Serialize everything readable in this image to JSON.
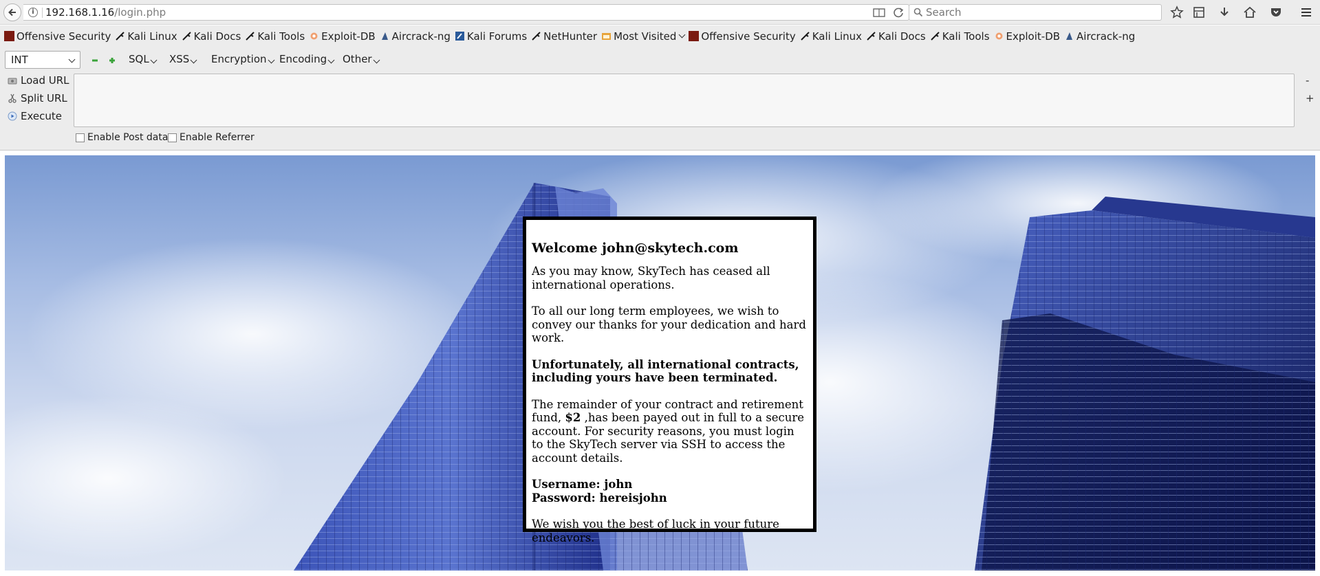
{
  "browser": {
    "url_host": "192.168.1.16",
    "url_path": "/login.php",
    "search_placeholder": "Search"
  },
  "bookmarks": [
    {
      "label": "Offensive Security",
      "icon": "offsec-icon"
    },
    {
      "label": "Kali Linux",
      "icon": "kali-dragon-icon"
    },
    {
      "label": "Kali Docs",
      "icon": "kali-dragon-icon"
    },
    {
      "label": "Kali Tools",
      "icon": "kali-dragon-icon"
    },
    {
      "label": "Exploit-DB",
      "icon": "exploitdb-icon"
    },
    {
      "label": "Aircrack-ng",
      "icon": "aircrack-icon"
    },
    {
      "label": "Kali Forums",
      "icon": "kali-forums-icon"
    },
    {
      "label": "NetHunter",
      "icon": "kali-dragon-icon"
    },
    {
      "label": "Most Visited",
      "icon": "folder-icon"
    },
    {
      "label": "Offensive Security",
      "icon": "offsec-icon"
    },
    {
      "label": "Kali Linux",
      "icon": "kali-dragon-icon"
    },
    {
      "label": "Kali Docs",
      "icon": "kali-dragon-icon"
    },
    {
      "label": "Kali Tools",
      "icon": "kali-dragon-icon"
    },
    {
      "label": "Exploit-DB",
      "icon": "exploitdb-icon"
    },
    {
      "label": "Aircrack-ng",
      "icon": "aircrack-icon"
    }
  ],
  "hackbar": {
    "select_value": "INT",
    "menus": [
      "SQL",
      "XSS",
      "Encryption",
      "Encoding",
      "Other"
    ],
    "load_url": "Load URL",
    "split_url": "Split URL",
    "execute": "Execute",
    "minus": "-",
    "plus": "+",
    "enable_post": "Enable Post data",
    "enable_referrer": "Enable Referrer"
  },
  "message": {
    "heading": "Welcome john@skytech.com",
    "p1": "As you may know, SkyTech has ceased all international operations.",
    "p2": "To all our long term employees, we wish to convey our thanks for your dedication and hard work.",
    "p3": "Unfortunately, all international contracts, including yours have been terminated.",
    "p4_a": "The remainder of your contract and retirement fund, ",
    "p4_b": "$2",
    "p4_c": " ,has been payed out in full to a secure account. For security reasons, you must login to the SkyTech server via SSH to access the account details.",
    "username": "Username: john",
    "password": "Password: hereisjohn",
    "p6": "We wish you the best of luck in your future endeavors."
  },
  "colors": {
    "chrome_bg": "#ececec",
    "message_border": "#000000",
    "sky": "#a5bbe3",
    "building": "#2a3c9c"
  }
}
